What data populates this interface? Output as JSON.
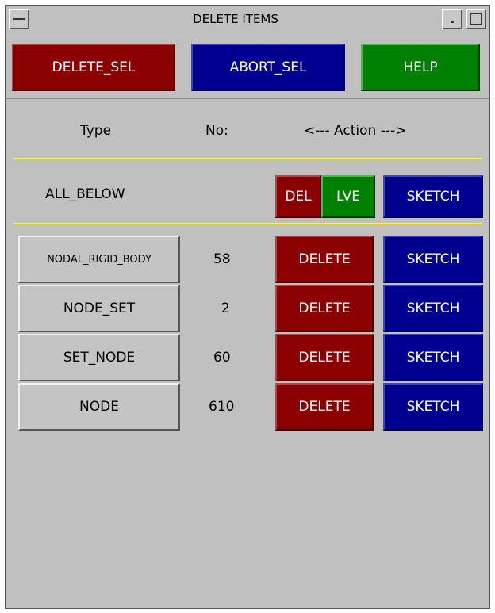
{
  "window": {
    "title": "DELETE ITEMS"
  },
  "toolbar": {
    "delete_sel": "DELETE_SEL",
    "abort_sel": "ABORT_SEL",
    "help": "HELP"
  },
  "header": {
    "type": "Type",
    "no": "No:",
    "action": "<--- Action --->"
  },
  "all_below": {
    "label": "ALL_BELOW",
    "del": "DEL",
    "lve": "LVE",
    "sketch": "SKETCH"
  },
  "rows": [
    {
      "type": "NODAL_RIGID_BODY",
      "no": "58",
      "delete": "DELETE",
      "sketch": "SKETCH"
    },
    {
      "type": "NODE_SET",
      "no": "2",
      "delete": "DELETE",
      "sketch": "SKETCH"
    },
    {
      "type": "SET_NODE",
      "no": "60",
      "delete": "DELETE",
      "sketch": "SKETCH"
    },
    {
      "type": "NODE",
      "no": "610",
      "delete": "DELETE",
      "sketch": "SKETCH"
    }
  ],
  "colors": {
    "red": "#8b0000",
    "blue": "#000090",
    "green": "#008000",
    "separator": "#ffff00",
    "panel": "#c0c0c0"
  }
}
